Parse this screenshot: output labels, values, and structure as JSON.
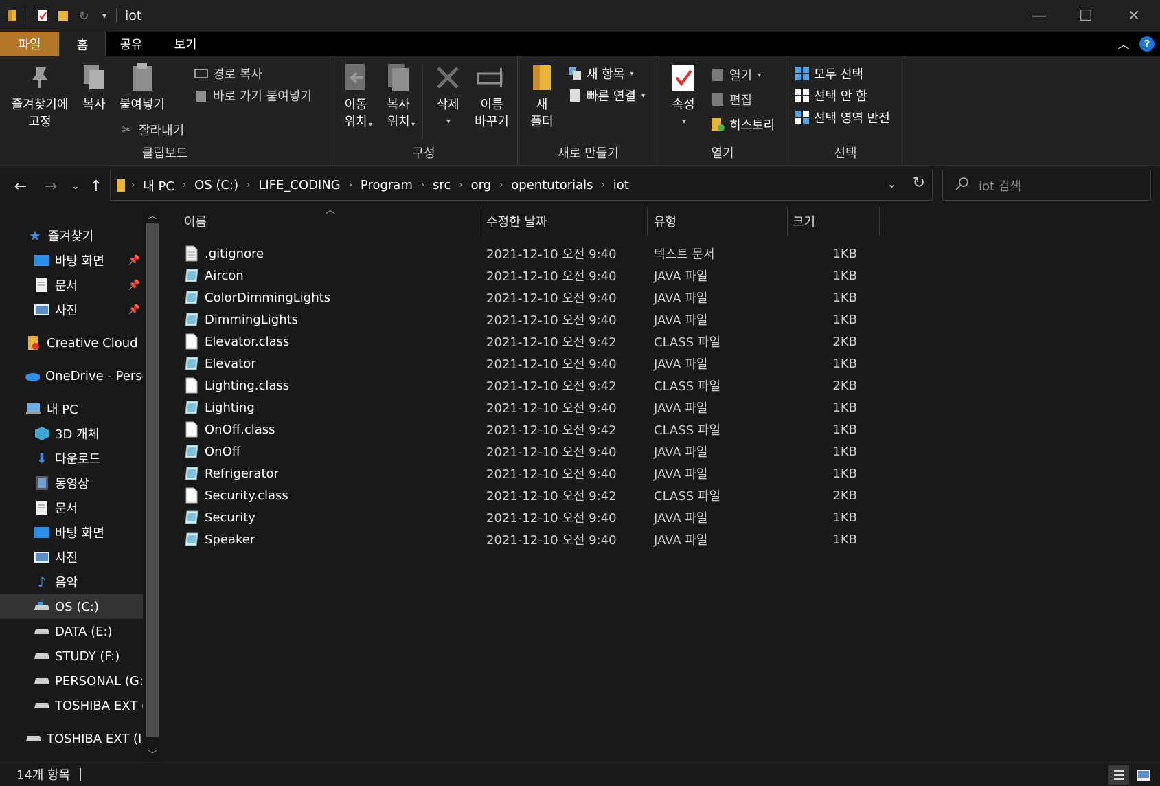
{
  "window": {
    "title": "iot",
    "controls": {
      "minimize": "—",
      "maximize": "☐",
      "close": "✕"
    }
  },
  "ribbon_tabs": [
    {
      "label": "파일"
    },
    {
      "label": "홈"
    },
    {
      "label": "공유"
    },
    {
      "label": "보기"
    }
  ],
  "ribbon": {
    "clipboard": {
      "group_label": "클립보드",
      "pin_quick_access": "즐겨찾기에\n고정",
      "copy": "복사",
      "paste": "붙여넣기",
      "copy_path": "경로 복사",
      "paste_shortcut": "바로 가기 붙여넣기",
      "cut": "잘라내기"
    },
    "organize": {
      "group_label": "구성",
      "move_to": "이동\n위치",
      "copy_to": "복사\n위치",
      "delete": "삭제",
      "rename": "이름\n바꾸기"
    },
    "new": {
      "group_label": "새로 만들기",
      "new_folder": "새\n폴더",
      "new_item": "새 항목",
      "easy_access": "빠른 연결"
    },
    "open": {
      "group_label": "열기",
      "properties": "속성",
      "open": "열기",
      "edit": "편집",
      "history": "히스토리"
    },
    "select": {
      "group_label": "선택",
      "select_all": "모두 선택",
      "select_none": "선택 안 함",
      "invert_selection": "선택 영역 반전"
    }
  },
  "address": {
    "breadcrumbs": [
      "내 PC",
      "OS (C:)",
      "LIFE_CODING",
      "Program",
      "src",
      "org",
      "opentutorials",
      "iot"
    ],
    "search_placeholder": "iot 검색"
  },
  "nav_pane": {
    "items": [
      {
        "label": "즐겨찾기",
        "icon": "star-icon"
      },
      {
        "label": "바탕 화면",
        "icon": "desktop-icon",
        "pinned": true
      },
      {
        "label": "문서",
        "icon": "documents-icon",
        "pinned": true
      },
      {
        "label": "사진",
        "icon": "pictures-icon",
        "pinned": true
      },
      {
        "label": "Creative Cloud Files",
        "icon": "creative-cloud-icon"
      },
      {
        "label": "OneDrive - Personal",
        "icon": "onedrive-icon"
      },
      {
        "label": "내 PC",
        "icon": "pc-icon"
      },
      {
        "label": "3D 개체",
        "icon": "3d-objects-icon"
      },
      {
        "label": "다운로드",
        "icon": "downloads-icon"
      },
      {
        "label": "동영상",
        "icon": "videos-icon"
      },
      {
        "label": "문서",
        "icon": "documents-icon"
      },
      {
        "label": "바탕 화면",
        "icon": "desktop-icon"
      },
      {
        "label": "사진",
        "icon": "pictures-icon"
      },
      {
        "label": "음악",
        "icon": "music-icon"
      },
      {
        "label": "OS (C:)",
        "icon": "drive-icon",
        "selected": true
      },
      {
        "label": "DATA (E:)",
        "icon": "drive-icon"
      },
      {
        "label": "STUDY (F:)",
        "icon": "drive-icon"
      },
      {
        "label": "PERSONAL (G:)",
        "icon": "drive-icon"
      },
      {
        "label": "TOSHIBA EXT (I:)",
        "icon": "drive-icon"
      },
      {
        "label": "TOSHIBA EXT (I:)",
        "icon": "drive-icon"
      }
    ]
  },
  "file_list": {
    "columns": [
      "이름",
      "수정한 날짜",
      "유형",
      "크기"
    ],
    "rows": [
      {
        "name": ".gitignore",
        "date": "2021-12-10 오전 9:40",
        "type": "텍스트 문서",
        "size": "1KB",
        "icon": "text-file-icon"
      },
      {
        "name": "Aircon",
        "date": "2021-12-10 오전 9:40",
        "type": "JAVA 파일",
        "size": "1KB",
        "icon": "java-file-icon"
      },
      {
        "name": "ColorDimmingLights",
        "date": "2021-12-10 오전 9:40",
        "type": "JAVA 파일",
        "size": "1KB",
        "icon": "java-file-icon"
      },
      {
        "name": "DimmingLights",
        "date": "2021-12-10 오전 9:40",
        "type": "JAVA 파일",
        "size": "1KB",
        "icon": "java-file-icon"
      },
      {
        "name": "Elevator.class",
        "date": "2021-12-10 오전 9:42",
        "type": "CLASS 파일",
        "size": "2KB",
        "icon": "blank-file-icon"
      },
      {
        "name": "Elevator",
        "date": "2021-12-10 오전 9:40",
        "type": "JAVA 파일",
        "size": "1KB",
        "icon": "java-file-icon"
      },
      {
        "name": "Lighting.class",
        "date": "2021-12-10 오전 9:42",
        "type": "CLASS 파일",
        "size": "2KB",
        "icon": "blank-file-icon"
      },
      {
        "name": "Lighting",
        "date": "2021-12-10 오전 9:40",
        "type": "JAVA 파일",
        "size": "1KB",
        "icon": "java-file-icon"
      },
      {
        "name": "OnOff.class",
        "date": "2021-12-10 오전 9:42",
        "type": "CLASS 파일",
        "size": "1KB",
        "icon": "blank-file-icon"
      },
      {
        "name": "OnOff",
        "date": "2021-12-10 오전 9:40",
        "type": "JAVA 파일",
        "size": "1KB",
        "icon": "java-file-icon"
      },
      {
        "name": "Refrigerator",
        "date": "2021-12-10 오전 9:40",
        "type": "JAVA 파일",
        "size": "1KB",
        "icon": "java-file-icon"
      },
      {
        "name": "Security.class",
        "date": "2021-12-10 오전 9:42",
        "type": "CLASS 파일",
        "size": "2KB",
        "icon": "blank-file-icon"
      },
      {
        "name": "Security",
        "date": "2021-12-10 오전 9:40",
        "type": "JAVA 파일",
        "size": "1KB",
        "icon": "java-file-icon"
      },
      {
        "name": "Speaker",
        "date": "2021-12-10 오전 9:40",
        "type": "JAVA 파일",
        "size": "1KB",
        "icon": "java-file-icon"
      }
    ]
  },
  "status_bar": {
    "item_count": "14개 항목"
  },
  "colors": {
    "accent_file_tab": "#b5762a",
    "help_blue": "#1a73d9",
    "folder_yellow": "#e8b43a",
    "background": "#191919"
  }
}
